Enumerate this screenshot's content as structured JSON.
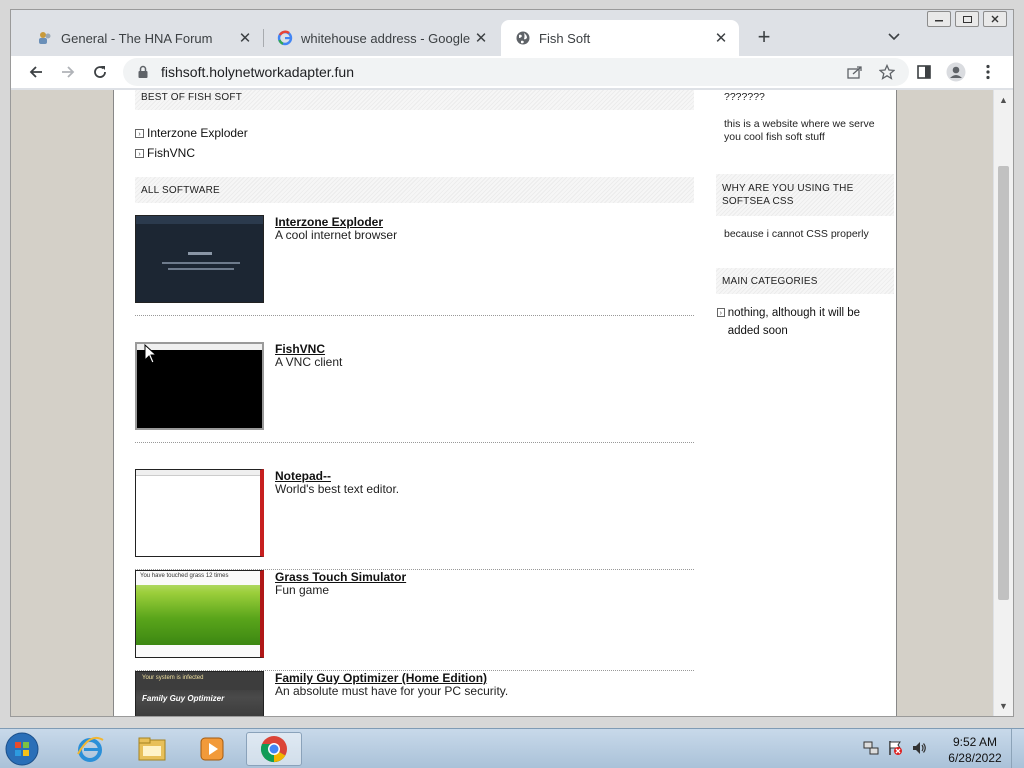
{
  "browser": {
    "tabs": [
      {
        "title": "General - The HNA Forum",
        "icon": "forum-icon",
        "active": false
      },
      {
        "title": "whitehouse address - Google Se",
        "icon": "google-icon",
        "active": false
      },
      {
        "title": "Fish Soft",
        "icon": "globe-icon",
        "active": true
      }
    ],
    "new_tab_symbol": "+",
    "tab_close_symbol": "✕",
    "url": "fishsoft.holynetworkadapter.fun"
  },
  "page": {
    "best_of_heading": "BEST OF FISH SOFT",
    "best_of_items": [
      {
        "label": "Interzone Exploder"
      },
      {
        "label": "FishVNC"
      }
    ],
    "all_software_heading": "ALL SOFTWARE",
    "software": [
      {
        "title": "Interzone Exploder",
        "desc": "A cool internet browser"
      },
      {
        "title": "FishVNC",
        "desc": "A VNC client"
      },
      {
        "title": "Notepad--",
        "desc": "World's best text editor."
      },
      {
        "title": "Grass Touch Simulator",
        "desc": "Fun game",
        "thumb_text": "You have touched grass 12 times"
      },
      {
        "title": "Family Guy Optimizer (Home Edition)",
        "desc": "An absolute must have for your PC security.",
        "thumb_text": "Your system is infected",
        "thumb_logo": "Family Guy Optimizer"
      }
    ],
    "sidebar": {
      "about_heading": "???????",
      "about_text": "this is a website where we serve you cool fish soft stuff",
      "why_heading": "WHY ARE YOU USING THE SOFTSEA CSS",
      "why_text": "because i cannot CSS properly",
      "categories_heading": "MAIN CATEGORIES",
      "categories": [
        {
          "label": "nothing, although it will be added soon"
        }
      ]
    }
  },
  "taskbar": {
    "time": "9:52 AM",
    "date": "6/28/2022",
    "pinned": [
      "internet-explorer",
      "file-explorer",
      "media-player",
      "chrome"
    ]
  }
}
